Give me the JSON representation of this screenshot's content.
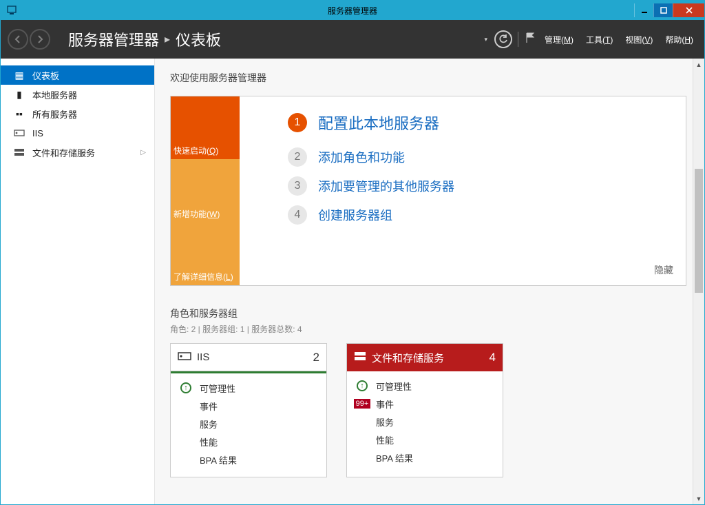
{
  "window": {
    "title": "服务器管理器"
  },
  "breadcrumb": {
    "app": "服务器管理器",
    "page": "仪表板"
  },
  "header_menu": {
    "manage": "管理(M)",
    "tools": "工具(T)",
    "view": "视图(V)",
    "help": "帮助(H)"
  },
  "sidebar": {
    "items": [
      {
        "label": "仪表板",
        "icon": "dashboard"
      },
      {
        "label": "本地服务器",
        "icon": "server"
      },
      {
        "label": "所有服务器",
        "icon": "servers"
      },
      {
        "label": "IIS",
        "icon": "iis"
      },
      {
        "label": "文件和存储服务",
        "icon": "storage",
        "expandable": true
      }
    ]
  },
  "welcome": {
    "heading": "欢迎使用服务器管理器",
    "tiles": [
      {
        "label": "快速启动(Q)"
      },
      {
        "label": "新增功能(W)"
      },
      {
        "label": "了解详细信息(L)"
      }
    ],
    "steps": [
      {
        "num": "1",
        "text": "配置此本地服务器",
        "primary": true
      },
      {
        "num": "2",
        "text": "添加角色和功能"
      },
      {
        "num": "3",
        "text": "添加要管理的其他服务器"
      },
      {
        "num": "4",
        "text": "创建服务器组"
      }
    ],
    "hide": "隐藏"
  },
  "roles": {
    "title": "角色和服务器组",
    "subtitle": "角色: 2 | 服务器组: 1 | 服务器总数: 4",
    "cards": [
      {
        "title": "IIS",
        "count": "2",
        "color": "white",
        "rows": [
          {
            "icon": "up",
            "text": "可管理性"
          },
          {
            "icon": "",
            "text": "事件"
          },
          {
            "icon": "",
            "text": "服务"
          },
          {
            "icon": "",
            "text": "性能"
          },
          {
            "icon": "",
            "text": "BPA 结果"
          }
        ]
      },
      {
        "title": "文件和存储服务",
        "count": "4",
        "color": "red",
        "rows": [
          {
            "icon": "up",
            "text": "可管理性"
          },
          {
            "icon": "badge",
            "text": "事件",
            "badge": "99+"
          },
          {
            "icon": "",
            "text": "服务"
          },
          {
            "icon": "",
            "text": "性能"
          },
          {
            "icon": "",
            "text": "BPA 结果"
          }
        ]
      }
    ]
  }
}
